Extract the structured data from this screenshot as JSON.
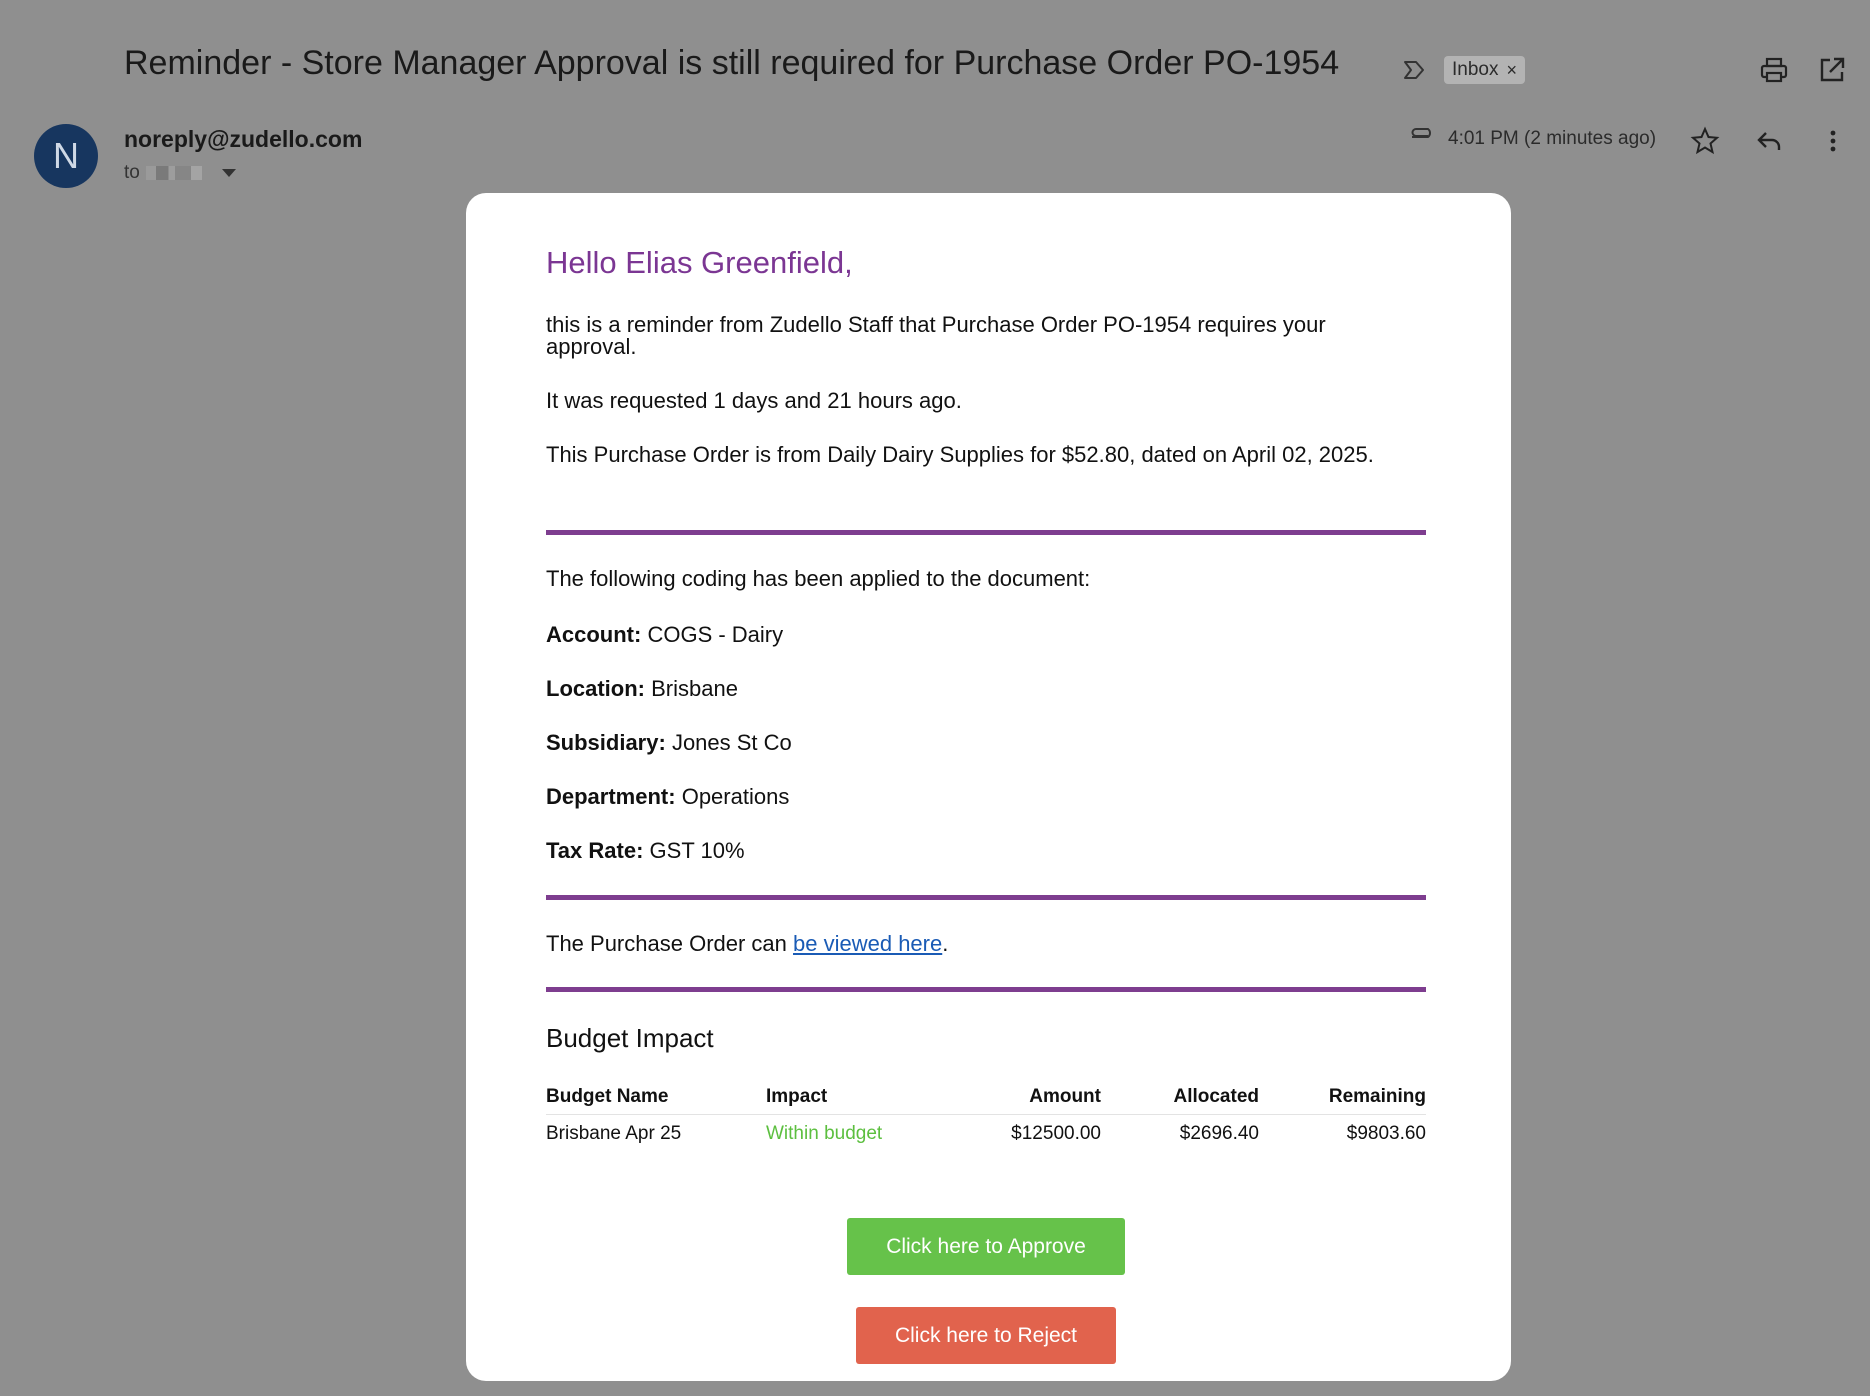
{
  "email": {
    "subject": "Reminder - Store Manager Approval is still required for Purchase Order PO-1954",
    "label_chip": "Inbox",
    "label_chip_close": "×",
    "avatar_letter": "N",
    "sender": "noreply@zudello.com",
    "to_prefix": "to",
    "time": "4:01 PM (2 minutes ago)"
  },
  "body": {
    "greeting": "Hello Elias Greenfield,",
    "p1": "this is a reminder from Zudello Staff that Purchase Order PO-1954 requires your approval.",
    "p2": "It was requested 1 days and 21 hours ago.",
    "p3": "This Purchase Order is from Daily Dairy Supplies for $52.80, dated on April 02, 2025.",
    "coding_intro": "The following coding has been applied to the document:",
    "coding": [
      {
        "label": "Account:",
        "value": "COGS - Dairy"
      },
      {
        "label": "Location:",
        "value": "Brisbane"
      },
      {
        "label": "Subsidiary:",
        "value": "Jones St Co"
      },
      {
        "label": "Department:",
        "value": "Operations"
      },
      {
        "label": "Tax Rate:",
        "value": "GST 10%"
      }
    ],
    "view_prefix": "The Purchase Order can ",
    "view_link": "be viewed here",
    "view_suffix": ".",
    "budget_title": "Budget Impact",
    "budget_headers": [
      "Budget Name",
      "Impact",
      "Amount",
      "Allocated",
      "Remaining"
    ],
    "budget_rows": [
      {
        "name": "Brisbane Apr 25",
        "impact": "Within budget",
        "amount": "$12500.00",
        "allocated": "$2696.40",
        "remaining": "$9803.60"
      }
    ],
    "approve_label": "Click here to Approve",
    "reject_label": "Click here to Reject"
  },
  "colors": {
    "accent_purple": "#7e3d8f",
    "approve_green": "#66c24a",
    "reject_red": "#e1634d",
    "impact_green": "#5cbf3f"
  },
  "icons": [
    "label-arrow-icon",
    "close-icon",
    "print-icon",
    "open-in-new-window-icon",
    "attachment-icon",
    "star-icon",
    "reply-icon",
    "more-vert-icon"
  ]
}
